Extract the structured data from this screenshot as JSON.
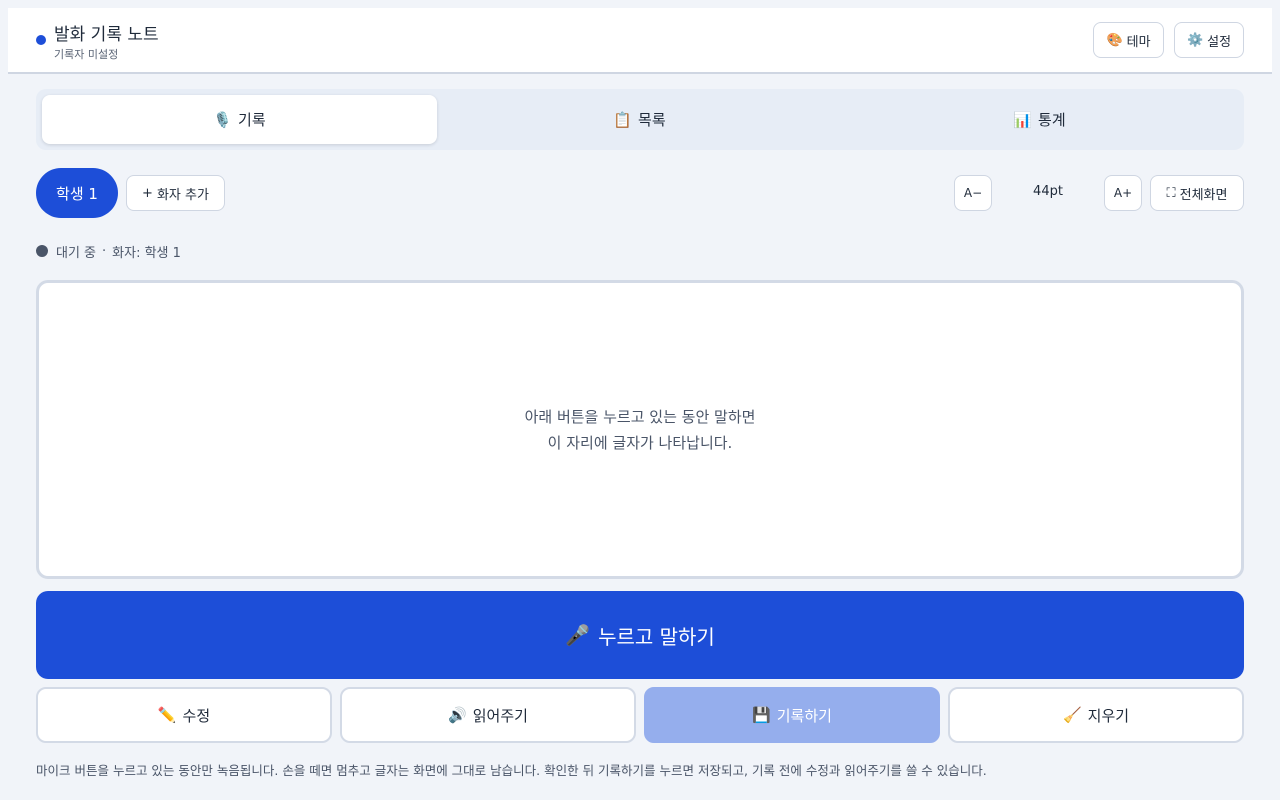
{
  "header": {
    "title": "발화 기록 노트",
    "subtitle": "기록자 미설정",
    "theme_icon": "🎨",
    "theme_label": "테마",
    "settings_icon": "⚙️",
    "settings_label": "설정"
  },
  "tabs": [
    {
      "icon": "🎙️",
      "label": "기록",
      "active": true
    },
    {
      "icon": "📋",
      "label": "목록",
      "active": false
    },
    {
      "icon": "📊",
      "label": "통계",
      "active": false
    }
  ],
  "speakers": {
    "current": "학생 1",
    "add_icon": "+",
    "add_label": "화자 추가"
  },
  "font_controls": {
    "decrease_label": "A−",
    "size": "44pt",
    "increase_label": "A+",
    "fullscreen_icon": "⛶",
    "fullscreen_label": "전체화면"
  },
  "status": {
    "state": "대기 중",
    "separator": "·",
    "speaker_text": "화자: 학생 1"
  },
  "canvas": {
    "line1": "아래 버튼을 누르고 있는 동안 말하면",
    "line2": "이 자리에 글자가 나타납니다."
  },
  "push_to_talk": {
    "icon": "🎤",
    "label": "누르고 말하기"
  },
  "actions": {
    "edit_icon": "✏️",
    "edit_label": "수정",
    "read_icon": "🔊",
    "read_label": "읽어주기",
    "save_icon": "💾",
    "save_label": "기록하기",
    "clear_icon": "🧹",
    "clear_label": "지우기"
  },
  "help_text": "마이크 버튼을 누르고 있는 동안만 녹음됩니다. 손을 떼면 멈추고 글자는 화면에 그대로 남습니다. 확인한 뒤 기록하기를 누르면 저장되고, 기록 전에 수정과 읽어주기를 쓸 수 있습니다.",
  "colors": {
    "accent": "#1d4ed8",
    "disabled": "#95aeed",
    "background": "#f1f4f9"
  }
}
